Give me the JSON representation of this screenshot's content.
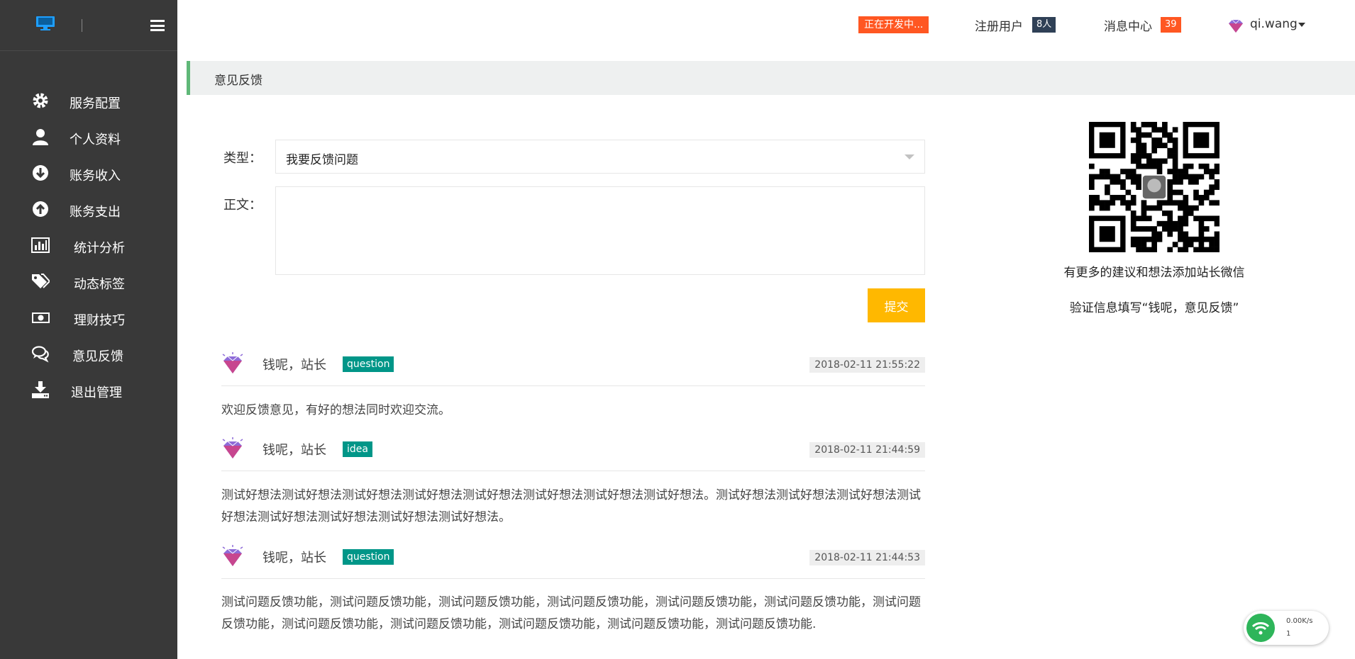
{
  "header": {
    "dev_badge": "正在开发中...",
    "registered_label": "注册用户",
    "registered_count": "8人",
    "messages_label": "消息中心",
    "messages_count": "39",
    "user_name": "qi.wang"
  },
  "sidebar": {
    "items": [
      {
        "label": "服务配置",
        "icon": "gear-icon"
      },
      {
        "label": "个人资料",
        "icon": "user-icon"
      },
      {
        "label": "账务收入",
        "icon": "arrow-down-circle-icon"
      },
      {
        "label": "账务支出",
        "icon": "arrow-up-circle-icon"
      },
      {
        "label": "统计分析",
        "icon": "bar-chart-icon"
      },
      {
        "label": "动态标签",
        "icon": "tags-icon"
      },
      {
        "label": "理财技巧",
        "icon": "money-icon"
      },
      {
        "label": "意见反馈",
        "icon": "comments-icon"
      },
      {
        "label": "退出管理",
        "icon": "download-icon"
      }
    ]
  },
  "page": {
    "title": "意见反馈"
  },
  "form": {
    "type_label": "类型：",
    "type_value": "我要反馈问题",
    "body_label": "正文：",
    "body_value": "",
    "submit_label": "提交"
  },
  "feedback": [
    {
      "name": "钱呢，站长",
      "tag": "question",
      "time": "2018-02-11 21:55:22",
      "body": "欢迎反馈意见，有好的想法同时欢迎交流。"
    },
    {
      "name": "钱呢，站长",
      "tag": "idea",
      "time": "2018-02-11 21:44:59",
      "body": "测试好想法测试好想法测试好想法测试好想法测试好想法测试好想法测试好想法测试好想法。测试好想法测试好想法测试好想法测试好想法测试好想法测试好想法测试好想法测试好想法。"
    },
    {
      "name": "钱呢，站长",
      "tag": "question",
      "time": "2018-02-11 21:44:53",
      "body": "测试问题反馈功能，测试问题反馈功能，测试问题反馈功能，测试问题反馈功能，测试问题反馈功能，测试问题反馈功能，测试问题反馈功能，测试问题反馈功能，测试问题反馈功能，测试问题反馈功能，测试问题反馈功能，测试问题反馈功能."
    }
  ],
  "qr_panel": {
    "caption1": "有更多的建议和想法添加站长微信",
    "caption2": "验证信息填写“钱呢，意见反馈”"
  },
  "net_widget": {
    "speed": "0.00K/s",
    "count": "1"
  },
  "colors": {
    "sidebar_bg": "#393939",
    "accent_green": "#5fb878",
    "tag_teal": "#009688",
    "submit_yellow": "#ffb800",
    "badge_orange": "#ff5722",
    "badge_dark": "#2f4056"
  }
}
